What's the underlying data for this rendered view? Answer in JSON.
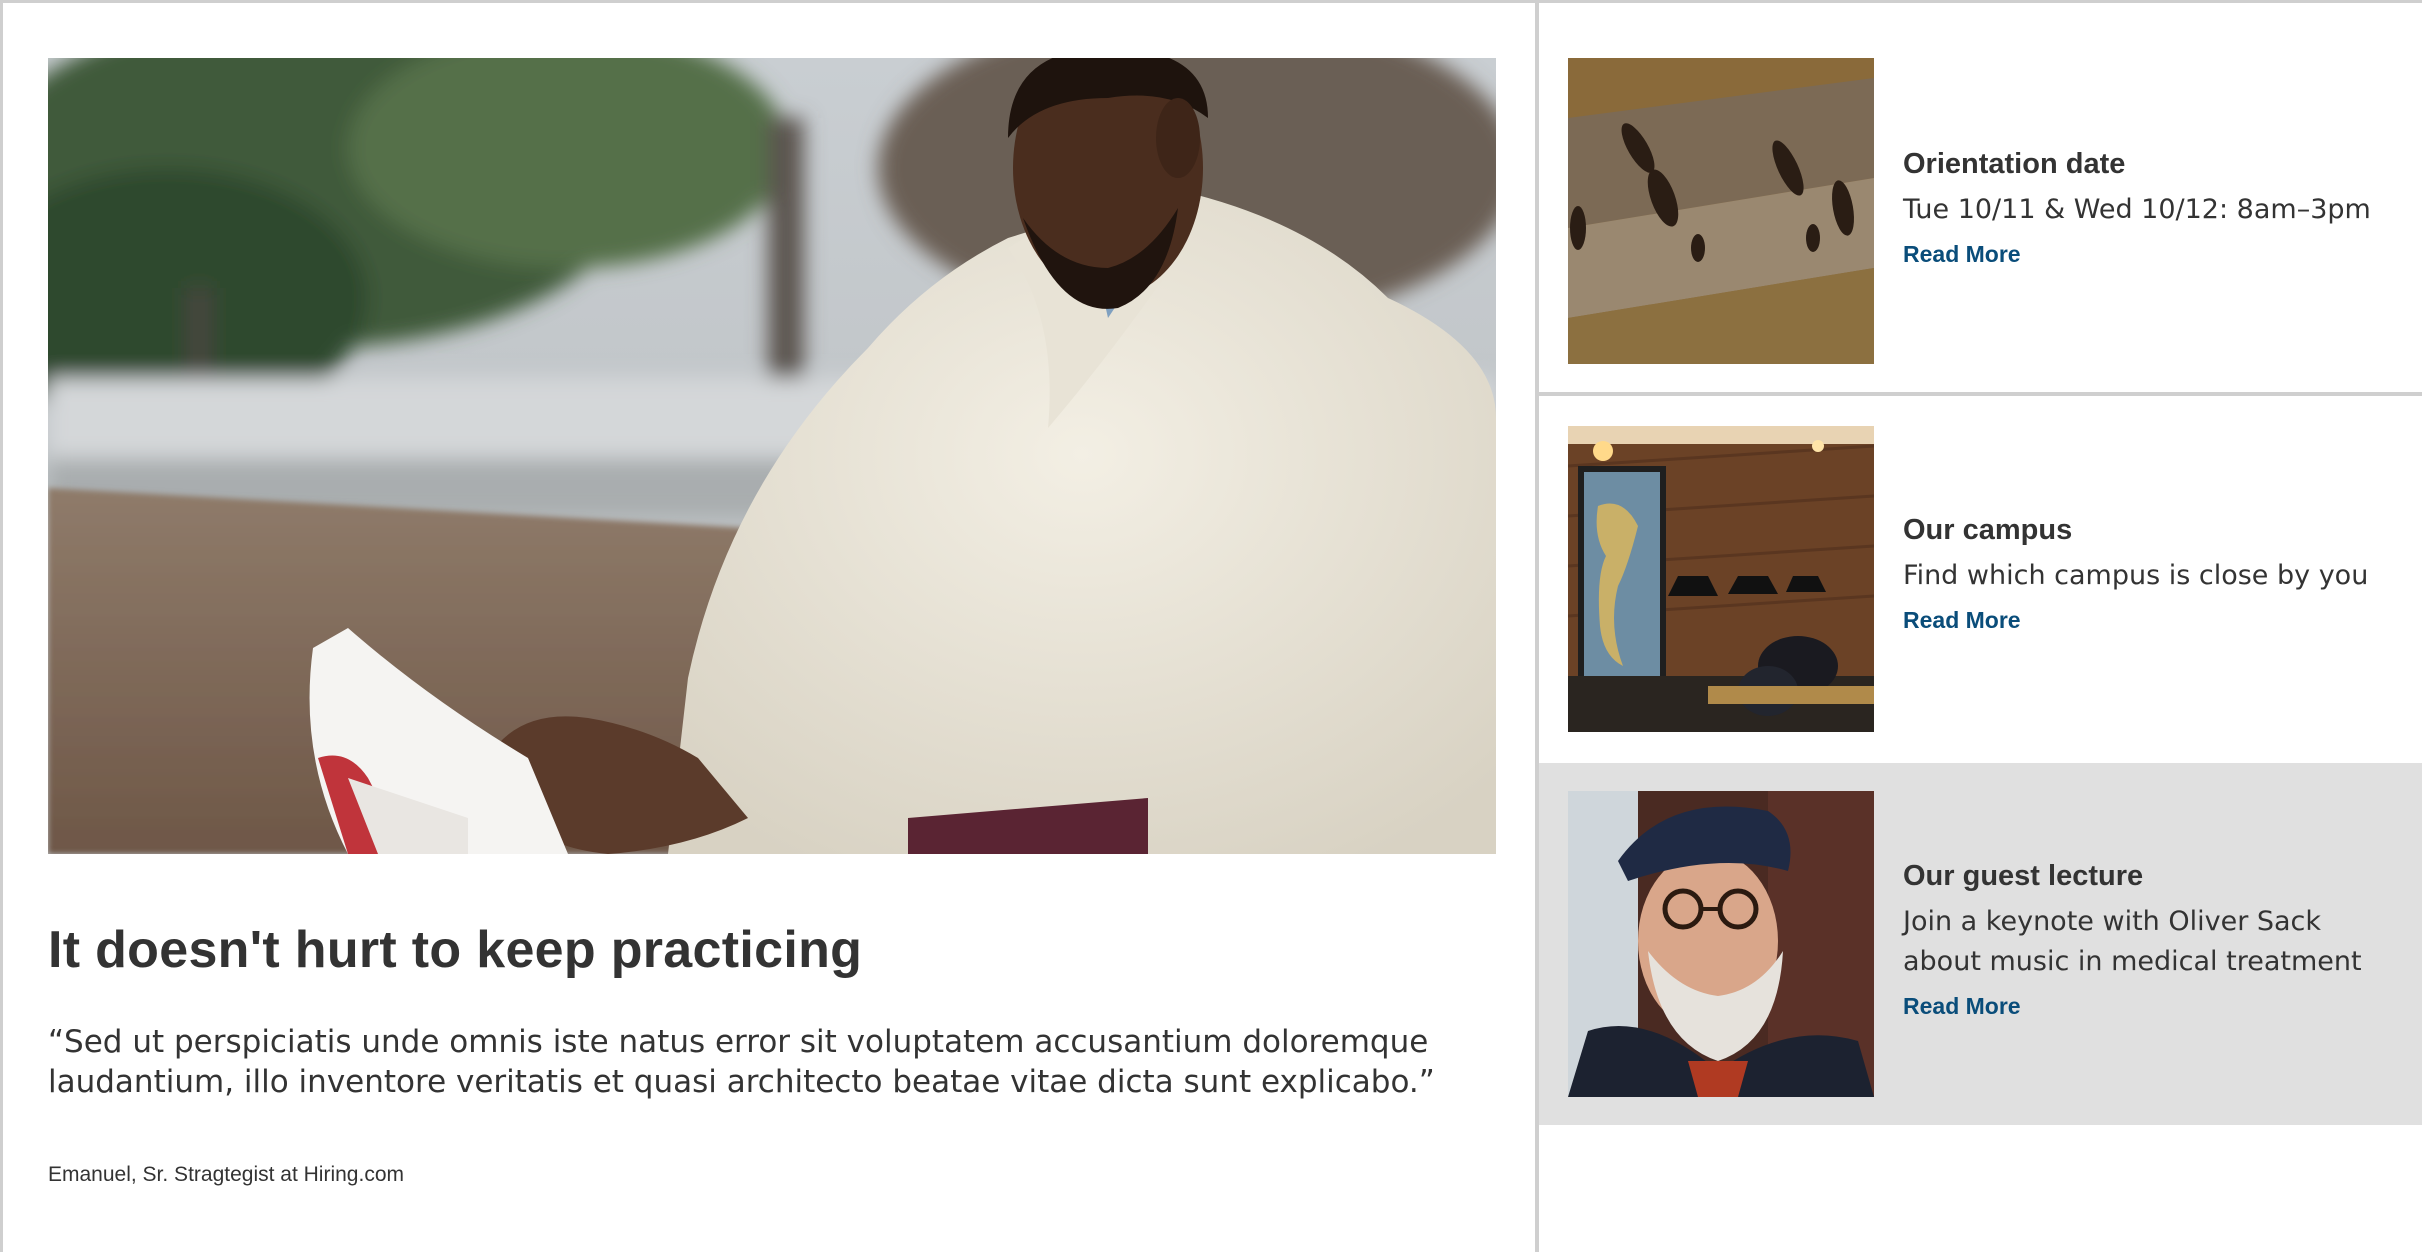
{
  "feature": {
    "image_alt": "Man reading a book outdoors",
    "headline": "It doesn't hurt to keep practicing",
    "quote": "“Sed ut perspiciatis unde omnis iste natus error sit voluptatem accusantium doloremque laudantium, illo inventore veritatis et quasi architecto beatae vitae dicta sunt explicabo.”",
    "attribution": "Emanuel, Sr. Stragtegist at Hiring.com"
  },
  "cards": [
    {
      "title": "Orientation date",
      "text": "Tue 10/11 & Wed 10/12: 8am–3pm",
      "link": "Read More",
      "image_alt": "Aerial view of students walking"
    },
    {
      "title": "Our campus",
      "text": "Find which campus is close by you",
      "link": "Read More",
      "image_alt": "Campus library interior with map"
    },
    {
      "title": "Our guest lecture",
      "text": "Join a keynote with Oliver Sack about music in medical treatment",
      "link": "Read More",
      "image_alt": "Portrait of guest lecturer"
    }
  ],
  "colors": {
    "text": "#333333",
    "link": "#0a4d7a",
    "border": "#cfcfcf",
    "highlight_background": "#e0e0e0"
  }
}
